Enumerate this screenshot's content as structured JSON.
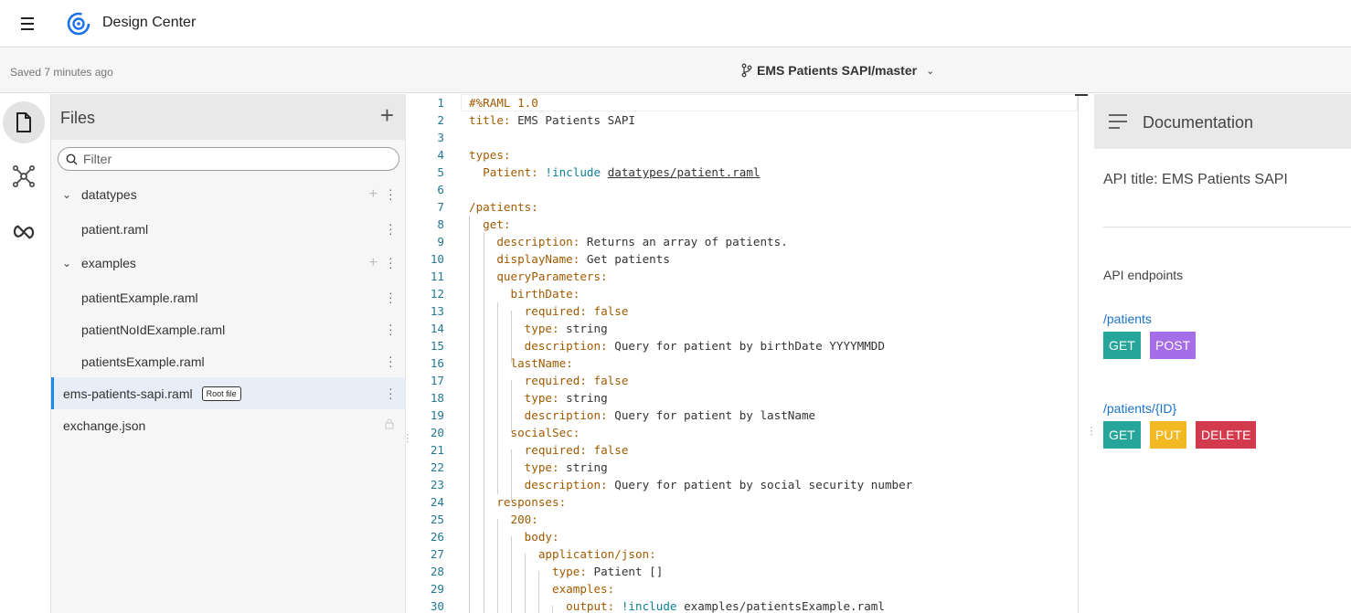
{
  "header": {
    "app_title": "Design Center"
  },
  "subbar": {
    "saved_status": "Saved 7 minutes ago",
    "branch": "EMS Patients SAPI/master"
  },
  "files": {
    "title": "Files",
    "filter_placeholder": "Filter",
    "items": [
      {
        "label": "datatypes",
        "type": "folder"
      },
      {
        "label": "patient.raml",
        "type": "file"
      },
      {
        "label": "examples",
        "type": "folder"
      },
      {
        "label": "patientExample.raml",
        "type": "file"
      },
      {
        "label": "patientNoIdExample.raml",
        "type": "file"
      },
      {
        "label": "patientsExample.raml",
        "type": "file"
      },
      {
        "label": "ems-patients-sapi.raml",
        "type": "file",
        "badge": "Root file",
        "selected": true
      },
      {
        "label": "exchange.json",
        "type": "file",
        "locked": true
      }
    ]
  },
  "editor": {
    "line_numbers": [
      "1",
      "2",
      "3",
      "4",
      "5",
      "6",
      "7",
      "8",
      "9",
      "10",
      "11",
      "12",
      "13",
      "14",
      "15",
      "16",
      "17",
      "18",
      "19",
      "20",
      "21",
      "22",
      "23",
      "24",
      "25",
      "26",
      "27",
      "28",
      "29",
      "30"
    ],
    "lines": [
      {
        "parts": [
          [
            "#%RAML 1.0",
            "k"
          ]
        ]
      },
      {
        "parts": [
          [
            "title:",
            "k"
          ],
          [
            " EMS Patients SAPI",
            "v"
          ]
        ]
      },
      {
        "parts": []
      },
      {
        "parts": [
          [
            "types:",
            "k"
          ]
        ]
      },
      {
        "parts": [
          [
            "  Patient:",
            "k"
          ],
          [
            " ",
            "v"
          ],
          [
            "!include",
            "t"
          ],
          [
            " ",
            "v"
          ],
          [
            "datatypes/patient.raml",
            "u"
          ]
        ]
      },
      {
        "parts": []
      },
      {
        "parts": [
          [
            "/patients:",
            "k"
          ]
        ]
      },
      {
        "parts": [
          [
            "  get:",
            "k"
          ]
        ]
      },
      {
        "parts": [
          [
            "    description:",
            "k"
          ],
          [
            " Returns an array of patients.",
            "v"
          ]
        ]
      },
      {
        "parts": [
          [
            "    displayName:",
            "k"
          ],
          [
            " Get patients",
            "v"
          ]
        ]
      },
      {
        "parts": [
          [
            "    queryParameters:",
            "k"
          ]
        ]
      },
      {
        "parts": [
          [
            "      birthDate:",
            "k"
          ]
        ]
      },
      {
        "parts": [
          [
            "        required:",
            "k"
          ],
          [
            " false",
            "k"
          ]
        ]
      },
      {
        "parts": [
          [
            "        type:",
            "k"
          ],
          [
            " string",
            "v"
          ]
        ]
      },
      {
        "parts": [
          [
            "        description:",
            "k"
          ],
          [
            " Query for patient by birthDate YYYYMMDD",
            "v"
          ]
        ]
      },
      {
        "parts": [
          [
            "      lastName:",
            "k"
          ]
        ]
      },
      {
        "parts": [
          [
            "        required:",
            "k"
          ],
          [
            " false",
            "k"
          ]
        ]
      },
      {
        "parts": [
          [
            "        type:",
            "k"
          ],
          [
            " string",
            "v"
          ]
        ]
      },
      {
        "parts": [
          [
            "        description:",
            "k"
          ],
          [
            " Query for patient by lastName",
            "v"
          ]
        ]
      },
      {
        "parts": [
          [
            "      socialSec:",
            "k"
          ]
        ]
      },
      {
        "parts": [
          [
            "        required:",
            "k"
          ],
          [
            " false",
            "k"
          ]
        ]
      },
      {
        "parts": [
          [
            "        type:",
            "k"
          ],
          [
            " string",
            "v"
          ]
        ]
      },
      {
        "parts": [
          [
            "        description:",
            "k"
          ],
          [
            " Query for patient by social security number",
            "v"
          ]
        ]
      },
      {
        "parts": [
          [
            "    responses:",
            "k"
          ]
        ]
      },
      {
        "parts": [
          [
            "      200:",
            "k"
          ]
        ]
      },
      {
        "parts": [
          [
            "        body:",
            "k"
          ]
        ]
      },
      {
        "parts": [
          [
            "          application/json:",
            "k"
          ]
        ]
      },
      {
        "parts": [
          [
            "            type:",
            "k"
          ],
          [
            " Patient []",
            "v"
          ]
        ]
      },
      {
        "parts": [
          [
            "            examples:",
            "k"
          ]
        ]
      },
      {
        "parts": [
          [
            "              output:",
            "k"
          ],
          [
            " ",
            "v"
          ],
          [
            "!include",
            "t"
          ],
          [
            " examples/patientsExample.raml",
            "v"
          ]
        ]
      }
    ]
  },
  "documentation": {
    "title": "Documentation",
    "api_title": "API title: EMS Patients SAPI",
    "endpoints_heading": "API endpoints",
    "endpoints": [
      {
        "path": "/patients",
        "methods": [
          "GET",
          "POST"
        ]
      },
      {
        "path": "/patients/{ID}",
        "methods": [
          "GET",
          "PUT",
          "DELETE"
        ]
      }
    ]
  },
  "colors": {
    "get": "#26a69a",
    "post": "#a66de8",
    "put": "#f3b923",
    "delete": "#d33a4d",
    "accent": "#1e88e5",
    "yaml_key": "#a05a00",
    "include_tag": "#0e7f94",
    "line_number": "#237893"
  },
  "icons": {
    "rail": [
      "file-icon",
      "graph-icon",
      "exchange-icon"
    ]
  }
}
